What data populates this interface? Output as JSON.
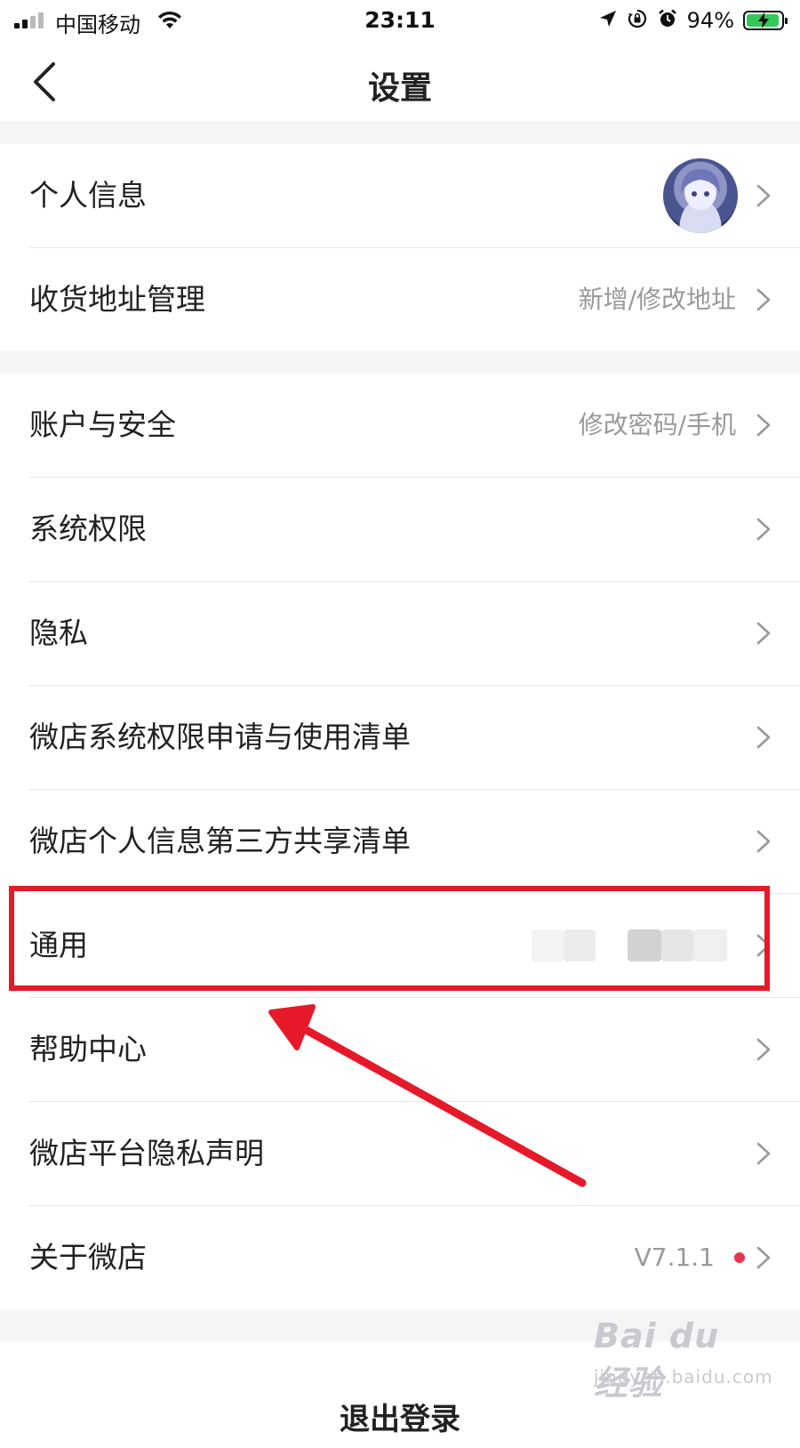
{
  "status_bar": {
    "carrier": "中国移动",
    "time": "23:11",
    "battery_percent": "94%",
    "icons": [
      "signal-icon",
      "wifi-icon",
      "location-icon",
      "orientation-lock-icon",
      "alarm-icon",
      "battery-charging-icon"
    ]
  },
  "nav": {
    "title": "设置",
    "back_icon": "chevron-left-icon"
  },
  "group1": {
    "items": [
      {
        "label": "个人信息",
        "value": "",
        "has_avatar": true
      },
      {
        "label": "收货地址管理",
        "value": "新增/修改地址"
      }
    ]
  },
  "group2": {
    "items": [
      {
        "label": "账户与安全",
        "value": "修改密码/手机"
      },
      {
        "label": "系统权限",
        "value": ""
      },
      {
        "label": "隐私",
        "value": ""
      },
      {
        "label": "微店系统权限申请与使用清单",
        "value": ""
      },
      {
        "label": "微店个人信息第三方共享清单",
        "value": ""
      },
      {
        "label": "通用",
        "value": "",
        "value_blurred": true
      },
      {
        "label": "帮助中心",
        "value": ""
      },
      {
        "label": "微店平台隐私声明",
        "value": ""
      },
      {
        "label": "关于微店",
        "value": "V7.1.1",
        "badge_dot": true
      }
    ]
  },
  "logout": {
    "label": "退出登录"
  },
  "annotation": {
    "highlight_color": "#e6192a",
    "highlighted_item": "通用"
  },
  "watermark": {
    "logo_text": "Bai du 经验",
    "sub_text": "jingyan.baidu.com"
  },
  "colors": {
    "background": "#f5f5f7",
    "card": "#ffffff",
    "label": "#222222",
    "secondary": "#999999",
    "badge": "#e8344e",
    "battery_fill": "#34c759"
  }
}
